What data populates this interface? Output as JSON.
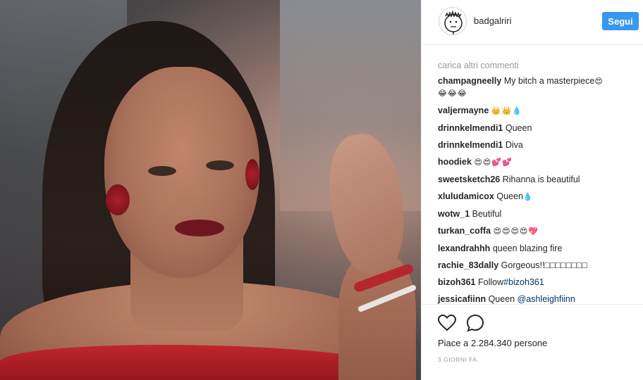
{
  "post": {
    "photo_description": "",
    "header": {
      "username": "badgalriri",
      "follow_label": "Segui"
    },
    "load_more_label": "carica altri commenti",
    "comments": [
      {
        "user": "champagneelly",
        "text": "My bitch a masterpiece",
        "emoji": "😍\n😂😂😂"
      },
      {
        "user": "valjermayne",
        "text": "",
        "emoji": "👑👑💧"
      },
      {
        "user": "drinnkelmendi1",
        "text": "Queen",
        "emoji": ""
      },
      {
        "user": "drinnkelmendi1",
        "text": "Diva",
        "emoji": ""
      },
      {
        "user": "hoodiek",
        "text": "",
        "emoji": "😍😍💕💕"
      },
      {
        "user": "sweetsketch26",
        "text": "Rihanna is beautiful",
        "emoji": ""
      },
      {
        "user": "xluludamicox",
        "text": "Queen",
        "emoji": "💧"
      },
      {
        "user": "wotw_1",
        "text": "Beutiful",
        "emoji": ""
      },
      {
        "user": "turkan_coffa",
        "text": "",
        "emoji": "😍😍😍😍💖"
      },
      {
        "user": "lexandrahhh",
        "text": "queen blazing fire",
        "emoji": ""
      },
      {
        "user": "rachie_83dally",
        "text": "Gorgeous!!□□□□□□□□",
        "emoji": ""
      },
      {
        "user": "bizoh361",
        "text": "Follow",
        "link": "#bizoh361"
      },
      {
        "user": "jessicafiinn",
        "text": "Queen",
        "link": "@ashleighfiinn"
      }
    ],
    "actions": {
      "like_icon": "heart-icon",
      "comment_icon": "comment-icon"
    },
    "likes_label": "Piace a 2.284.340 persone",
    "time_label": "3 GIORNI FA"
  }
}
